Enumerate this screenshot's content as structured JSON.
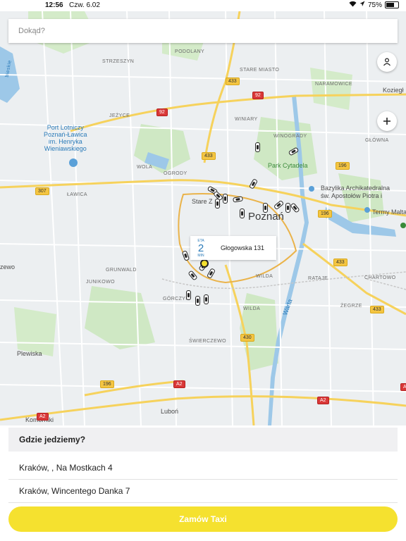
{
  "status_bar": {
    "time": "12:56",
    "date": "Czw. 6.02",
    "battery": "75%",
    "battery_level": 0.75
  },
  "search": {
    "placeholder": "Dokąd?"
  },
  "map": {
    "labels": {
      "strzeszyn": "STRZESZYN",
      "podolany": "PODOLANY",
      "stare_miasto": "STARE MIASTO",
      "naramowice": "NARAMOWICE",
      "koziegl": "Koziegł",
      "jezyce": "JEŻYCE",
      "winiary": "WINIARY",
      "winogrady": "WINOGRADY",
      "glowna": "GŁÓWNA",
      "airport_line1": "Port Lotniczy",
      "airport_line2": "Poznań-Ławica",
      "airport_line3": "im. Henryka",
      "airport_line4": "Wieniawskiego",
      "park_cytadela": "Park Cytadela",
      "wola": "WOLA",
      "ogrody": "OGRODY",
      "lawica": "ŁAWICA",
      "stare_z": "Stare Z",
      "poznan": "Poznań",
      "bazylika_line1": "Bazylika Archikatedralna",
      "bazylika_line2": "św. Apostołów Piotra i",
      "termy": "Termy Malta",
      "grunwald": "GRUNWALD",
      "junikowo": "JUNIKOWO",
      "wilda_upper": "WILDA",
      "rataje": "RATAJE",
      "chartowo": "CHARTOWO",
      "gorczyn": "GÓRCZYN",
      "wilda_lower": "WILDA",
      "warta": "Warta",
      "zegrze": "ŻEGRZE",
      "zewo": "zewo",
      "plewiska": "Plewiska",
      "swierczewo": "ŚWIERCZEWO",
      "lubon": "Luboń",
      "komorniki": "Komorniki",
      "bieskie": "bieskie"
    },
    "shields": {
      "r433a": "433",
      "r92a": "92",
      "r92b": "92",
      "r433b": "433",
      "r196a": "196",
      "r307": "307",
      "r196b": "196",
      "r433c": "433",
      "r433d": "433",
      "r430": "430",
      "r196c": "196",
      "ra2a": "A2",
      "ra2b": "A2",
      "ra2c": "A2",
      "ra2d": "A2"
    },
    "eta": {
      "label": "ETA",
      "value": "2",
      "unit": "MIN",
      "address": "Głogowska 131"
    }
  },
  "panel": {
    "header": "Gdzie jedziemy?",
    "addresses": [
      "Kraków, , Na Mostkach 4",
      "Kraków, Wincentego Danka 7"
    ],
    "order_button": "Zamów Taxi"
  },
  "colors": {
    "accent": "#f5e12f",
    "map_bg": "#eceff1",
    "park": "#cfe8c4",
    "water": "#9dc8e8",
    "road_major": "#f6d25c"
  }
}
